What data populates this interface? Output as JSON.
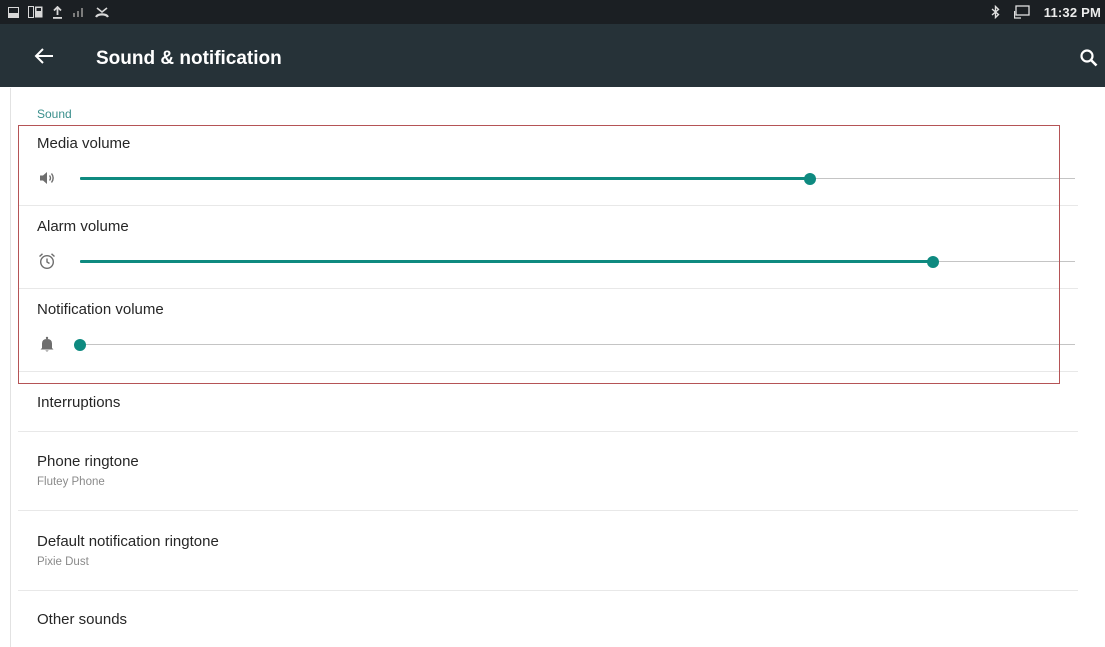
{
  "status_bar": {
    "left_icons": [
      "screenshot-icon",
      "sim-icon",
      "upload-icon",
      "signal-icon",
      "missed-call-icon"
    ],
    "right_icons": [
      "bluetooth-icon",
      "cast-icon"
    ],
    "time": "11:32 PM"
  },
  "toolbar": {
    "back_icon": "arrow-left-icon",
    "title": "Sound & notification",
    "search_icon": "search-icon"
  },
  "sound_section": {
    "header": "Sound",
    "volumes": [
      {
        "label": "Media volume",
        "icon": "speaker-icon",
        "level": 0.734
      },
      {
        "label": "Alarm volume",
        "icon": "alarm-clock-icon",
        "level": 0.857
      },
      {
        "label": "Notification volume",
        "icon": "bell-icon",
        "level": 0.0
      }
    ]
  },
  "preferences": [
    {
      "title": "Interruptions",
      "summary": ""
    },
    {
      "title": "Phone ringtone",
      "summary": "Flutey Phone"
    },
    {
      "title": "Default notification ringtone",
      "summary": "Pixie Dust"
    },
    {
      "title": "Other sounds",
      "summary": ""
    }
  ],
  "colors": {
    "accent": "#0e8a80",
    "section_header": "#3a8f8c",
    "toolbar": "#263238",
    "status_bar": "#1b1f23",
    "highlight_box": "#b55456"
  }
}
